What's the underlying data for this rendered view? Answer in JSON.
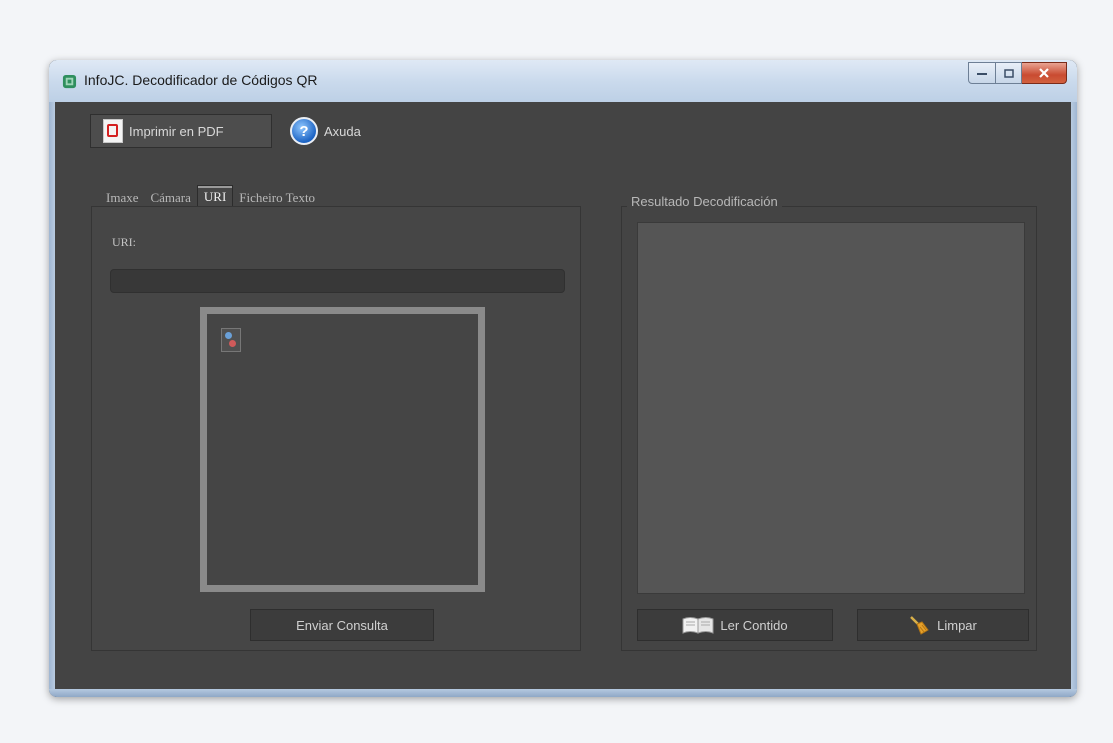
{
  "window": {
    "title": "InfoJC. Decodificador de Códigos QR"
  },
  "toolbar": {
    "pdf_label": "Imprimir en PDF",
    "help_label": "Axuda"
  },
  "tabs": [
    {
      "label": "Imaxe",
      "active": false
    },
    {
      "label": "Cámara",
      "active": false
    },
    {
      "label": "URI",
      "active": true
    },
    {
      "label": "Ficheiro Texto",
      "active": false
    }
  ],
  "uri_panel": {
    "label": "URI:",
    "value": "",
    "send_label": "Enviar Consulta"
  },
  "result_panel": {
    "title": "Resultado Decodificación",
    "content": "",
    "read_label": "Ler Contido",
    "clear_label": "Limpar"
  },
  "colors": {
    "background": "#444444",
    "panel": "#464646",
    "result_area": "#555555",
    "text": "#d0d0d0"
  }
}
